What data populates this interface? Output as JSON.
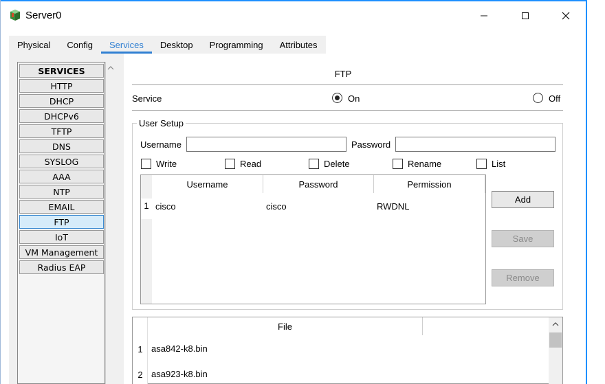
{
  "window": {
    "title": "Server0",
    "minimize": "—",
    "maximize": "☐",
    "close": "✕"
  },
  "tabs": [
    {
      "label": "Physical"
    },
    {
      "label": "Config"
    },
    {
      "label": "Services",
      "active": true
    },
    {
      "label": "Desktop"
    },
    {
      "label": "Programming"
    },
    {
      "label": "Attributes"
    }
  ],
  "services": {
    "header": "SERVICES",
    "items": [
      "HTTP",
      "DHCP",
      "DHCPv6",
      "TFTP",
      "DNS",
      "SYSLOG",
      "AAA",
      "NTP",
      "EMAIL",
      "FTP",
      "IoT",
      "VM Management",
      "Radius EAP"
    ],
    "selected": "FTP"
  },
  "ftp": {
    "title": "FTP",
    "service_label": "Service",
    "on_label": "On",
    "off_label": "Off",
    "service_state": "On",
    "user_setup": {
      "legend": "User Setup",
      "username_label": "Username",
      "username_value": "",
      "password_label": "Password",
      "password_value": "",
      "permissions": [
        {
          "label": "Write",
          "checked": false
        },
        {
          "label": "Read",
          "checked": false
        },
        {
          "label": "Delete",
          "checked": false
        },
        {
          "label": "Rename",
          "checked": false
        },
        {
          "label": "List",
          "checked": false
        }
      ],
      "columns": [
        "Username",
        "Password",
        "Permission"
      ],
      "rows": [
        {
          "num": "1",
          "username": "cisco",
          "password": "cisco",
          "permission": "RWDNL"
        }
      ],
      "add_label": "Add",
      "save_label": "Save",
      "remove_label": "Remove"
    },
    "files": {
      "header": "File",
      "items": [
        {
          "num": "1",
          "name": "asa842-k8.bin"
        },
        {
          "num": "2",
          "name": "asa923-k8.bin"
        }
      ]
    }
  },
  "colors": {
    "accent": "#2f7fd2",
    "window_edge": "#1e90ff",
    "selected_service_bg": "#d6ecfa"
  },
  "icons": {
    "app": "server-app-icon",
    "scroll_up": "chevron-up-icon"
  }
}
